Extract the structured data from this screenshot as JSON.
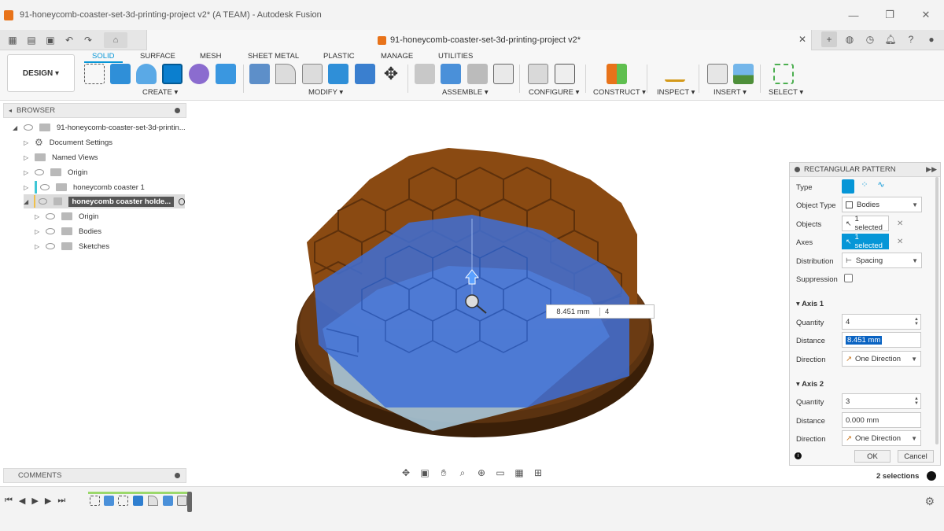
{
  "window": {
    "title": "91-honeycomb-coaster-set-3d-printing-project v2* (A TEAM) - Autodesk Fusion",
    "controls": [
      "—",
      "❐",
      "✕"
    ]
  },
  "tabbar": {
    "doc_title": "91-honeycomb-coaster-set-3d-printing-project v2*",
    "close": "✕"
  },
  "toolbar": {
    "design_button": "DESIGN ▾",
    "workspace_tabs": [
      "SOLID",
      "SURFACE",
      "MESH",
      "SHEET METAL",
      "PLASTIC",
      "MANAGE",
      "UTILITIES"
    ],
    "groups": [
      "CREATE ▾",
      "MODIFY ▾",
      "ASSEMBLE ▾",
      "CONFIGURE ▾",
      "CONSTRUCT ▾",
      "INSPECT ▾",
      "INSERT ▾",
      "SELECT ▾"
    ]
  },
  "browser": {
    "header": "BROWSER",
    "items": [
      {
        "label": "91-honeycomb-coaster-set-3d-printin..."
      },
      {
        "label": "Document Settings"
      },
      {
        "label": "Named Views"
      },
      {
        "label": "Origin"
      },
      {
        "label": "honeycomb coaster 1"
      },
      {
        "label": "honeycomb coaster holde..."
      },
      {
        "label": "Origin"
      },
      {
        "label": "Bodies"
      },
      {
        "label": "Sketches"
      }
    ]
  },
  "comments": {
    "label": "COMMENTS"
  },
  "viewport": {
    "dimension_value": "8.451 mm",
    "dimension_count": "4"
  },
  "panel": {
    "title": "RECTANGULAR PATTERN",
    "labels": {
      "type": "Type",
      "object_type": "Object Type",
      "objects": "Objects",
      "axes": "Axes",
      "distribution": "Distribution",
      "suppression": "Suppression",
      "axis1": "Axis 1",
      "axis2": "Axis 2",
      "quantity": "Quantity",
      "distance": "Distance",
      "direction": "Direction"
    },
    "object_type_value": "Bodies",
    "objects_value": "1 selected",
    "axes_value": "1 selected",
    "distribution_value": "Spacing",
    "axis1": {
      "quantity": "4",
      "distance": "8.451 mm",
      "direction": "One Direction"
    },
    "axis2": {
      "quantity": "3",
      "distance": "0.000 mm",
      "direction": "One Direction"
    },
    "ok": "OK",
    "cancel": "Cancel"
  },
  "status": {
    "selections": "2 selections"
  },
  "colors": {
    "accent": "#0696d7",
    "brown": "#8a4a12",
    "blue_body": "#3e6fd6"
  }
}
